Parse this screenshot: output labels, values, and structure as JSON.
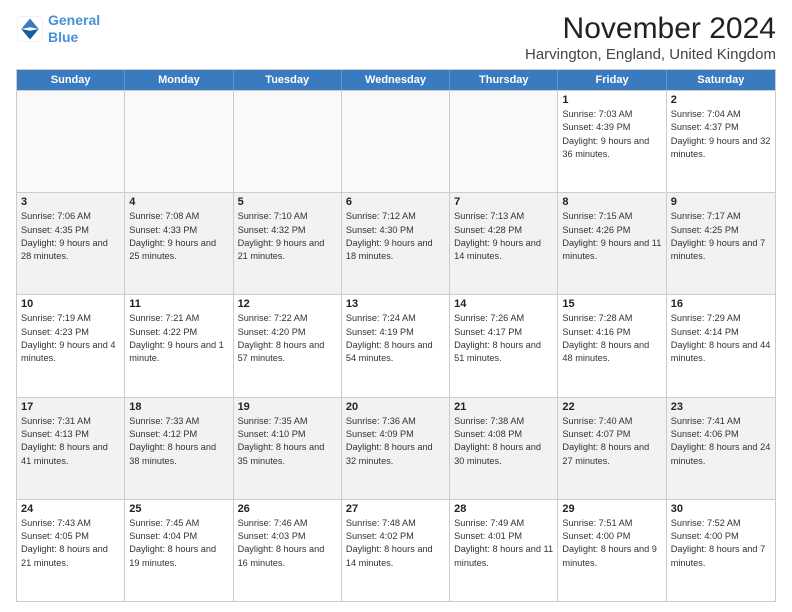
{
  "logo": {
    "line1": "General",
    "line2": "Blue"
  },
  "title": "November 2024",
  "location": "Harvington, England, United Kingdom",
  "header": {
    "days": [
      "Sunday",
      "Monday",
      "Tuesday",
      "Wednesday",
      "Thursday",
      "Friday",
      "Saturday"
    ]
  },
  "rows": [
    {
      "cells": [
        {
          "day": "",
          "info": "",
          "empty": true
        },
        {
          "day": "",
          "info": "",
          "empty": true
        },
        {
          "day": "",
          "info": "",
          "empty": true
        },
        {
          "day": "",
          "info": "",
          "empty": true
        },
        {
          "day": "",
          "info": "",
          "empty": true
        },
        {
          "day": "1",
          "info": "Sunrise: 7:03 AM\nSunset: 4:39 PM\nDaylight: 9 hours and 36 minutes."
        },
        {
          "day": "2",
          "info": "Sunrise: 7:04 AM\nSunset: 4:37 PM\nDaylight: 9 hours and 32 minutes."
        }
      ]
    },
    {
      "cells": [
        {
          "day": "3",
          "info": "Sunrise: 7:06 AM\nSunset: 4:35 PM\nDaylight: 9 hours and 28 minutes."
        },
        {
          "day": "4",
          "info": "Sunrise: 7:08 AM\nSunset: 4:33 PM\nDaylight: 9 hours and 25 minutes."
        },
        {
          "day": "5",
          "info": "Sunrise: 7:10 AM\nSunset: 4:32 PM\nDaylight: 9 hours and 21 minutes."
        },
        {
          "day": "6",
          "info": "Sunrise: 7:12 AM\nSunset: 4:30 PM\nDaylight: 9 hours and 18 minutes."
        },
        {
          "day": "7",
          "info": "Sunrise: 7:13 AM\nSunset: 4:28 PM\nDaylight: 9 hours and 14 minutes."
        },
        {
          "day": "8",
          "info": "Sunrise: 7:15 AM\nSunset: 4:26 PM\nDaylight: 9 hours and 11 minutes."
        },
        {
          "day": "9",
          "info": "Sunrise: 7:17 AM\nSunset: 4:25 PM\nDaylight: 9 hours and 7 minutes."
        }
      ]
    },
    {
      "cells": [
        {
          "day": "10",
          "info": "Sunrise: 7:19 AM\nSunset: 4:23 PM\nDaylight: 9 hours and 4 minutes."
        },
        {
          "day": "11",
          "info": "Sunrise: 7:21 AM\nSunset: 4:22 PM\nDaylight: 9 hours and 1 minute."
        },
        {
          "day": "12",
          "info": "Sunrise: 7:22 AM\nSunset: 4:20 PM\nDaylight: 8 hours and 57 minutes."
        },
        {
          "day": "13",
          "info": "Sunrise: 7:24 AM\nSunset: 4:19 PM\nDaylight: 8 hours and 54 minutes."
        },
        {
          "day": "14",
          "info": "Sunrise: 7:26 AM\nSunset: 4:17 PM\nDaylight: 8 hours and 51 minutes."
        },
        {
          "day": "15",
          "info": "Sunrise: 7:28 AM\nSunset: 4:16 PM\nDaylight: 8 hours and 48 minutes."
        },
        {
          "day": "16",
          "info": "Sunrise: 7:29 AM\nSunset: 4:14 PM\nDaylight: 8 hours and 44 minutes."
        }
      ]
    },
    {
      "cells": [
        {
          "day": "17",
          "info": "Sunrise: 7:31 AM\nSunset: 4:13 PM\nDaylight: 8 hours and 41 minutes."
        },
        {
          "day": "18",
          "info": "Sunrise: 7:33 AM\nSunset: 4:12 PM\nDaylight: 8 hours and 38 minutes."
        },
        {
          "day": "19",
          "info": "Sunrise: 7:35 AM\nSunset: 4:10 PM\nDaylight: 8 hours and 35 minutes."
        },
        {
          "day": "20",
          "info": "Sunrise: 7:36 AM\nSunset: 4:09 PM\nDaylight: 8 hours and 32 minutes."
        },
        {
          "day": "21",
          "info": "Sunrise: 7:38 AM\nSunset: 4:08 PM\nDaylight: 8 hours and 30 minutes."
        },
        {
          "day": "22",
          "info": "Sunrise: 7:40 AM\nSunset: 4:07 PM\nDaylight: 8 hours and 27 minutes."
        },
        {
          "day": "23",
          "info": "Sunrise: 7:41 AM\nSunset: 4:06 PM\nDaylight: 8 hours and 24 minutes."
        }
      ]
    },
    {
      "cells": [
        {
          "day": "24",
          "info": "Sunrise: 7:43 AM\nSunset: 4:05 PM\nDaylight: 8 hours and 21 minutes."
        },
        {
          "day": "25",
          "info": "Sunrise: 7:45 AM\nSunset: 4:04 PM\nDaylight: 8 hours and 19 minutes."
        },
        {
          "day": "26",
          "info": "Sunrise: 7:46 AM\nSunset: 4:03 PM\nDaylight: 8 hours and 16 minutes."
        },
        {
          "day": "27",
          "info": "Sunrise: 7:48 AM\nSunset: 4:02 PM\nDaylight: 8 hours and 14 minutes."
        },
        {
          "day": "28",
          "info": "Sunrise: 7:49 AM\nSunset: 4:01 PM\nDaylight: 8 hours and 11 minutes."
        },
        {
          "day": "29",
          "info": "Sunrise: 7:51 AM\nSunset: 4:00 PM\nDaylight: 8 hours and 9 minutes."
        },
        {
          "day": "30",
          "info": "Sunrise: 7:52 AM\nSunset: 4:00 PM\nDaylight: 8 hours and 7 minutes."
        }
      ]
    }
  ]
}
